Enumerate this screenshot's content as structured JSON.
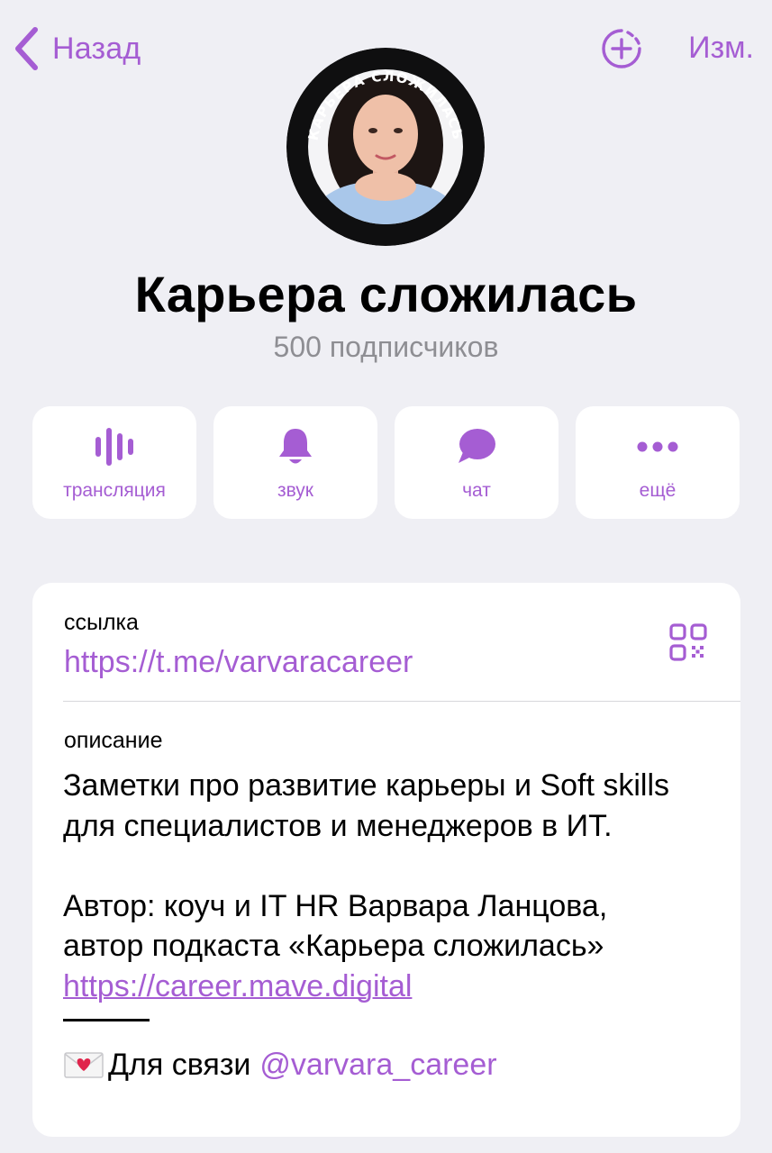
{
  "nav": {
    "back_label": "Назад",
    "edit_label": "Изм."
  },
  "avatar": {
    "ring_text": "КАРЬЕРА СЛОЖИЛАСЬ"
  },
  "channel": {
    "title": "Карьера сложилась",
    "subscribers": "500 подписчиков"
  },
  "actions": [
    {
      "label": "трансляция",
      "icon": "live-stream-icon"
    },
    {
      "label": "звук",
      "icon": "bell-icon"
    },
    {
      "label": "чат",
      "icon": "chat-bubble-icon"
    },
    {
      "label": "ещё",
      "icon": "more-dots-icon"
    }
  ],
  "info": {
    "link_caption": "ссылка",
    "link_value": "https://t.me/varvaracareer",
    "description_caption": "описание",
    "description_p1": "Заметки про развитие карьеры и Soft skills для специалистов и менеджеров в ИТ.",
    "description_p2_line1": "Автор: коуч и IT HR Варвара Ланцова,",
    "description_p2_line2": "автор подкаста «Карьера сложилась»",
    "description_link": "https://career.mave.digital",
    "contact_prefix": "Для связи",
    "contact_handle": "@varvara_career"
  },
  "colors": {
    "accent": "#a55dd3",
    "background": "#efeff4",
    "card": "#ffffff",
    "secondary_text": "#8e8e93"
  }
}
